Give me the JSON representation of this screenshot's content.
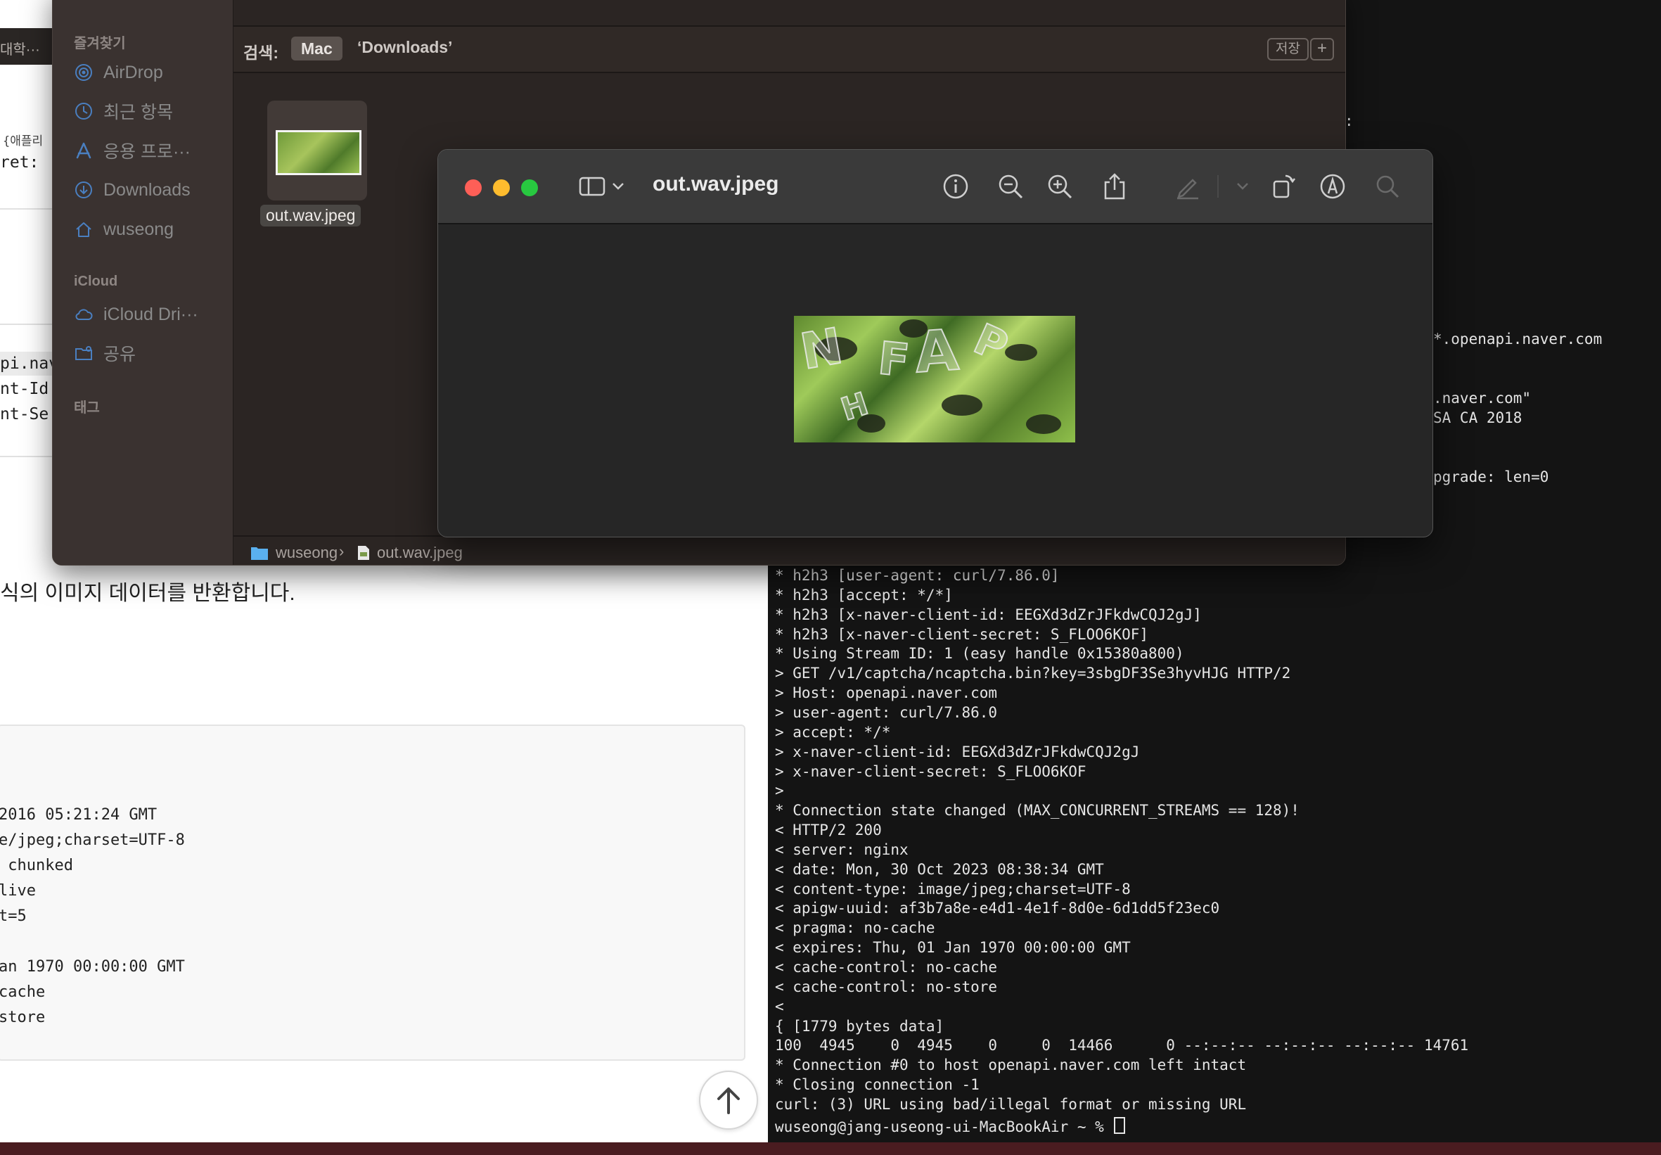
{
  "browser": {
    "tab_fragment": "대학···",
    "code_fragments": [
      "{애플리",
      "ret:",
      "pi.nav",
      "nt-Id",
      "nt-Se"
    ],
    "doc_text": "식의 이미지 데이터를 반환합니다.",
    "response_lines": [
      "2016 05:21:24 GMT",
      "e/jpeg;charset=UTF-8",
      " chunked",
      "live",
      "t=5",
      "",
      "an 1970 00:00:00 GMT",
      "cache",
      "store"
    ],
    "scroll_top_icon": "arrow-up-icon"
  },
  "terminal": {
    "partial_lines": [
      ":",
      "*.openapi.naver.com",
      ".naver.com\"",
      "SA CA 2018",
      "pgrade: len=0"
    ],
    "lines": [
      "* h2h3 [user-agent: curl/7.86.0]",
      "* h2h3 [accept: */*]",
      "* h2h3 [x-naver-client-id: EEGXd3dZrJFkdwCQJ2gJ]",
      "* h2h3 [x-naver-client-secret: S_FLOO6KOF]",
      "* Using Stream ID: 1 (easy handle 0x15380a800)",
      "> GET /v1/captcha/ncaptcha.bin?key=3sbgDF3Se3hyvHJG HTTP/2",
      "> Host: openapi.naver.com",
      "> user-agent: curl/7.86.0",
      "> accept: */*",
      "> x-naver-client-id: EEGXd3dZrJFkdwCQJ2gJ",
      "> x-naver-client-secret: S_FLOO6KOF",
      ">",
      "* Connection state changed (MAX_CONCURRENT_STREAMS == 128)!",
      "< HTTP/2 200",
      "< server: nginx",
      "< date: Mon, 30 Oct 2023 08:38:34 GMT",
      "< content-type: image/jpeg;charset=UTF-8",
      "< apigw-uuid: af3b7a8e-e4d1-4e1f-8d0e-6d1dd5f23ec0",
      "< pragma: no-cache",
      "< expires: Thu, 01 Jan 1970 00:00:00 GMT",
      "< cache-control: no-cache",
      "< cache-control: no-store",
      "<",
      "{ [1779 bytes data]",
      "100  4945    0  4945    0     0  14466      0 --:--:-- --:--:-- --:--:-- 14761",
      "* Connection #0 to host openapi.naver.com left intact",
      "* Closing connection -1",
      "curl: (3) URL using bad/illegal format or missing URL"
    ],
    "prompt": "wuseong@jang-useong-ui-MacBookAir ~ % "
  },
  "finder": {
    "sidebar": {
      "favorites_header": "즐겨찾기",
      "favorites": [
        {
          "label": "AirDrop",
          "icon": "airdrop-icon"
        },
        {
          "label": "최근 항목",
          "icon": "clock-icon"
        },
        {
          "label": "응용 프로···",
          "icon": "applications-icon"
        },
        {
          "label": "Downloads",
          "icon": "downloads-icon"
        },
        {
          "label": "wuseong",
          "icon": "home-icon"
        }
      ],
      "icloud_header": "iCloud",
      "icloud": [
        {
          "label": "iCloud Dri···",
          "icon": "cloud-icon"
        },
        {
          "label": "공유",
          "icon": "shared-folder-icon"
        }
      ],
      "tags_header": "태그"
    },
    "search": {
      "label": "검색:",
      "scope_selected": "Mac",
      "scope_other": "‘Downloads’",
      "save_label": "저장",
      "add_label": "+"
    },
    "file": {
      "name": "out.wav.jpeg"
    },
    "path": {
      "folder": "wuseong",
      "separator": "›",
      "file": "out.wav.jpeg"
    }
  },
  "preview": {
    "title": "out.wav.jpeg",
    "toolbar_icons": [
      "sidebar-icon",
      "chevron-down-icon",
      "info-icon",
      "zoom-out-icon",
      "zoom-in-icon",
      "share-icon",
      "markup-pen-icon",
      "chevron-down-icon",
      "rotate-icon",
      "annotate-icon",
      "search-icon"
    ],
    "image_description_icon": "captcha-image"
  }
}
